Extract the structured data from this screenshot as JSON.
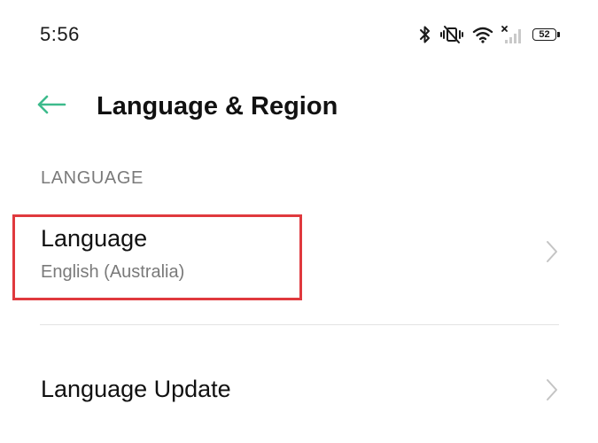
{
  "status_bar": {
    "time": "5:56",
    "battery_level": "52",
    "icons": [
      "bluetooth-icon",
      "vibrate-mute-icon",
      "wifi-icon",
      "cellular-no-signal-icon",
      "battery-icon"
    ]
  },
  "header": {
    "back_icon": "arrow-left-icon",
    "title": "Language & Region"
  },
  "sections": {
    "language_header": "LANGUAGE"
  },
  "items": {
    "language": {
      "title": "Language",
      "subtitle": "English (Australia)"
    },
    "language_update": {
      "title": "Language Update"
    }
  },
  "colors": {
    "accent": "#3dbb8c",
    "highlight": "#e0393e",
    "secondary_text": "#7a7a7a",
    "chevron": "#c4c4c4"
  }
}
